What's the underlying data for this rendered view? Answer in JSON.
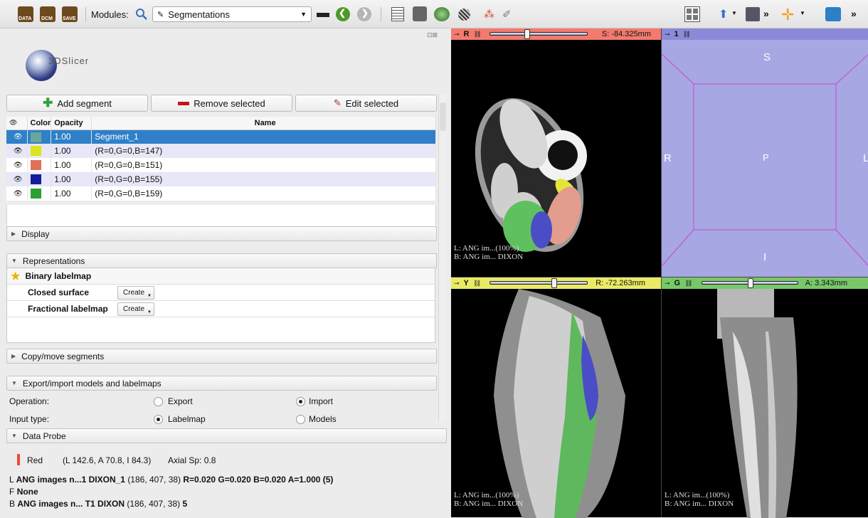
{
  "toolbar": {
    "data_label": "DATA",
    "dcm_label": "DCM",
    "save_label": "SAVE",
    "modules_label": "Modules:",
    "module_selected": "Segmentations",
    "more_label": "»"
  },
  "logo_text": "3DSlicer",
  "buttons": {
    "add_segment": "Add segment",
    "remove_selected": "Remove selected",
    "edit_selected": "Edit selected"
  },
  "segment_table": {
    "headers": {
      "color": "Color",
      "opacity": "Opacity",
      "name": "Name"
    },
    "rows": [
      {
        "color": "#6aa79a",
        "opacity": "1.00",
        "name": "Segment_1"
      },
      {
        "color": "#dde51a",
        "opacity": "1.00",
        "name": "(R=0,G=0,B=147)"
      },
      {
        "color": "#e07158",
        "opacity": "1.00",
        "name": "(R=0,G=0,B=151)"
      },
      {
        "color": "#151a9c",
        "opacity": "1.00",
        "name": "(R=0,G=0,B=155)"
      },
      {
        "color": "#2aa032",
        "opacity": "1.00",
        "name": "(R=0,G=0,B=159)"
      }
    ]
  },
  "sections": {
    "display": "Display",
    "representations": "Representations",
    "copy_move": "Copy/move segments",
    "export_import": "Export/import models and labelmaps",
    "data_probe": "Data Probe"
  },
  "representations": {
    "binary": "Binary labelmap",
    "closed_surface": "Closed surface",
    "fractional": "Fractional labelmap",
    "create_label": "Create"
  },
  "export_import": {
    "operation_label": "Operation:",
    "export": "Export",
    "import": "Import",
    "input_type_label": "Input type:",
    "labelmap": "Labelmap",
    "models": "Models"
  },
  "probe": {
    "view": "Red",
    "coords": "(L 142.6, A 70.8, I 84.3)",
    "spacing": "Axial Sp: 0.8",
    "line_l_prefix": "L",
    "line_l_name": "ANG images n...1 DIXON_1",
    "line_l_ijk": "(186, 407,  38)",
    "line_l_val": "R=0.020 G=0.020 B=0.020 A=1.000 (5)",
    "line_f_prefix": "F",
    "line_f_val": "None",
    "line_b_prefix": "B",
    "line_b_name": "ANG images n... T1 DIXON",
    "line_b_ijk": "(186, 407,  38)",
    "line_b_val": "5"
  },
  "views": {
    "red": {
      "letter": "R",
      "offset": "S: -84.325mm",
      "color": "#f27b6e",
      "label_l": "L: ANG im...(100%)",
      "label_b": "B: ANG im... DIXON"
    },
    "threeD": {
      "letter": "1",
      "color": "#8a8ad8",
      "s": "S",
      "r": "R",
      "p": "P",
      "l": "L",
      "i": "I"
    },
    "yellow": {
      "letter": "Y",
      "offset": "R: -72.263mm",
      "color": "#eaea66",
      "label_l": "L: ANG im...(100%)",
      "label_b": "B: ANG im... DIXON"
    },
    "green": {
      "letter": "G",
      "offset": "A: 3.343mm",
      "color": "#78c86a",
      "label_l": "L: ANG im...(100%)",
      "label_b": "B: ANG im... DIXON"
    }
  },
  "colors": {
    "selection": "#2f80c8",
    "threeD_bg": "#a7a7e3"
  }
}
